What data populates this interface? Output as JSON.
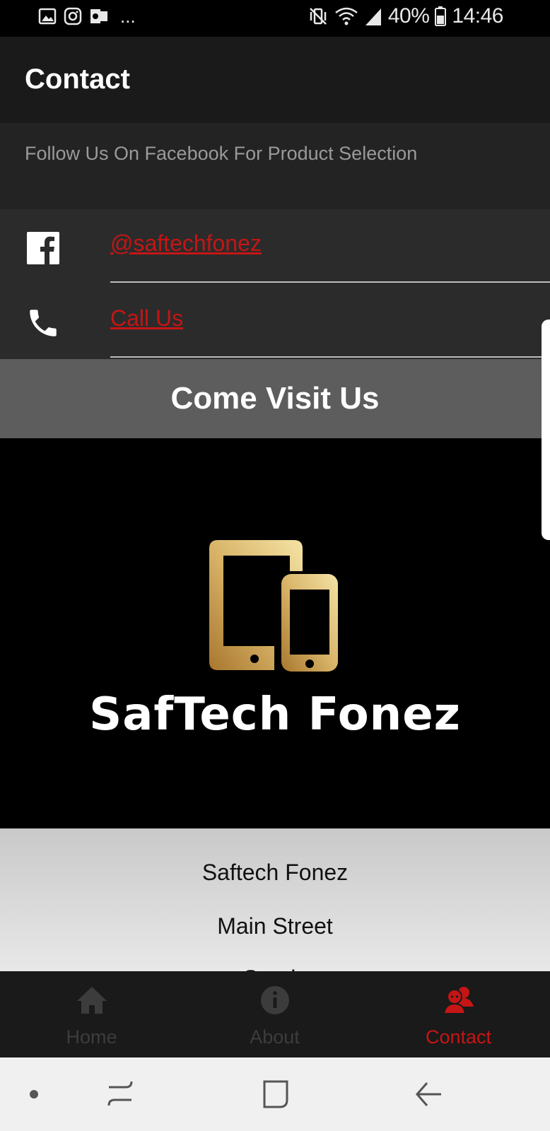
{
  "status_bar": {
    "battery": "40%",
    "time": "14:46",
    "left_icons": [
      "gallery-icon",
      "instagram-icon",
      "outlook-icon"
    ],
    "more": "...",
    "right_icons": [
      "vibrate-icon",
      "wifi-icon",
      "signal-icon",
      "battery-icon"
    ]
  },
  "header": {
    "title": "Contact"
  },
  "banner": {
    "text": "Follow Us On Facebook For Product Selection"
  },
  "contacts": [
    {
      "icon": "facebook-icon",
      "label": "@saftechfonez"
    },
    {
      "icon": "phone-icon",
      "label": "Call Us"
    }
  ],
  "visit": {
    "heading": "Come Visit Us"
  },
  "logo": {
    "brand": "SafTech Fonez"
  },
  "address": {
    "lines": [
      "Saftech Fonez",
      "Main Street",
      "Sandy"
    ]
  },
  "nav": {
    "items": [
      {
        "label": "Home",
        "icon": "home-icon",
        "active": false
      },
      {
        "label": "About",
        "icon": "info-icon",
        "active": false
      },
      {
        "label": "Contact",
        "icon": "contact-people-icon",
        "active": true
      }
    ]
  },
  "colors": {
    "accent": "#c51515",
    "gold": "#c8a14e",
    "header_bg": "#1a1a1a"
  }
}
